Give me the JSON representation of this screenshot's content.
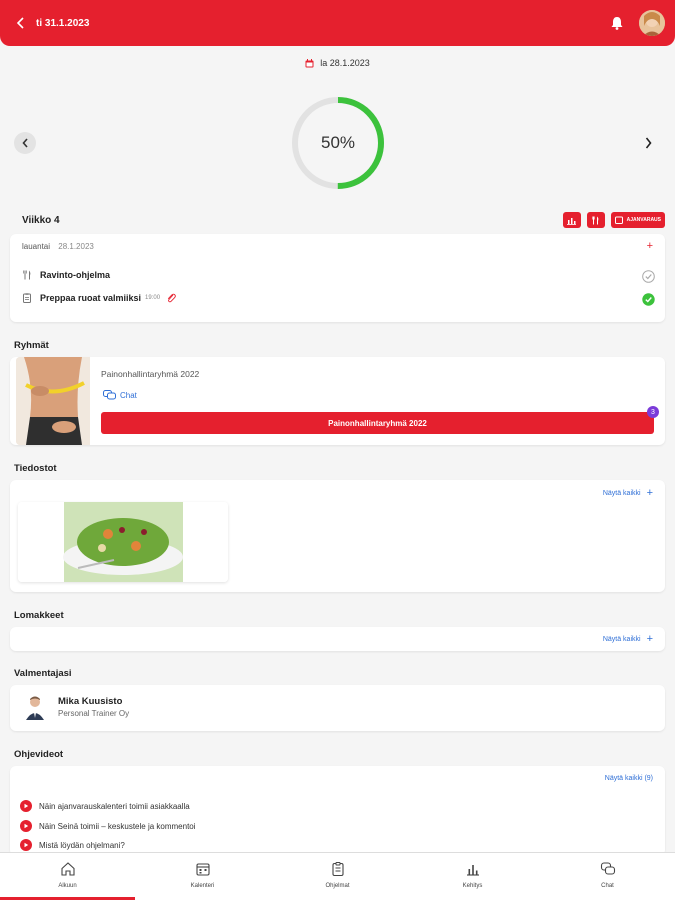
{
  "header": {
    "title": "ti 31.1.2023"
  },
  "date_label": "la 28.1.2023",
  "progress": {
    "label": "50%",
    "value": 0.5
  },
  "week": {
    "title": "Viikko 4",
    "button_label": "AJANVARAUS"
  },
  "day": {
    "weekday": "lauantai",
    "date": "28.1.2023",
    "tasks": [
      {
        "label": "Ravinto-ohjelma",
        "time": "",
        "done": false
      },
      {
        "label": "Preppaa ruoat valmiiksi",
        "time": "19:00",
        "done": true
      }
    ]
  },
  "groups": {
    "title": "Ryhmät",
    "name": "Painonhallintaryhmä 2022",
    "chat_label": "Chat",
    "bar_label": "Painonhallintaryhmä 2022",
    "badge": "3"
  },
  "files": {
    "title": "Tiedostot",
    "show_all": "Näytä kaikki"
  },
  "forms": {
    "title": "Lomakkeet",
    "show_all": "Näytä kaikki"
  },
  "coaches": {
    "title": "Valmentajasi",
    "name": "Mika Kuusisto",
    "company": "Personal Trainer Oy"
  },
  "videos": {
    "title": "Ohjevideot",
    "show_all": "Näytä kaikki (9)",
    "items": [
      "Näin ajanvarauskalenteri toimii asiakkaalla",
      "Näin Seinä toimii – keskustele ja kommentoi",
      "Mistä löydän ohjelmani?"
    ]
  },
  "bottom_nav": [
    {
      "label": "Alkuun",
      "icon": "home-icon"
    },
    {
      "label": "Kalenteri",
      "icon": "calendar-icon"
    },
    {
      "label": "Ohjelmat",
      "icon": "clipboard-icon"
    },
    {
      "label": "Kehitys",
      "icon": "chart-icon"
    },
    {
      "label": "Chat",
      "icon": "chat-icon"
    }
  ],
  "colors": {
    "primary": "#e5202e",
    "progress": "#3cc23c",
    "link": "#2f6fd6",
    "badge": "#7b3bd9"
  }
}
